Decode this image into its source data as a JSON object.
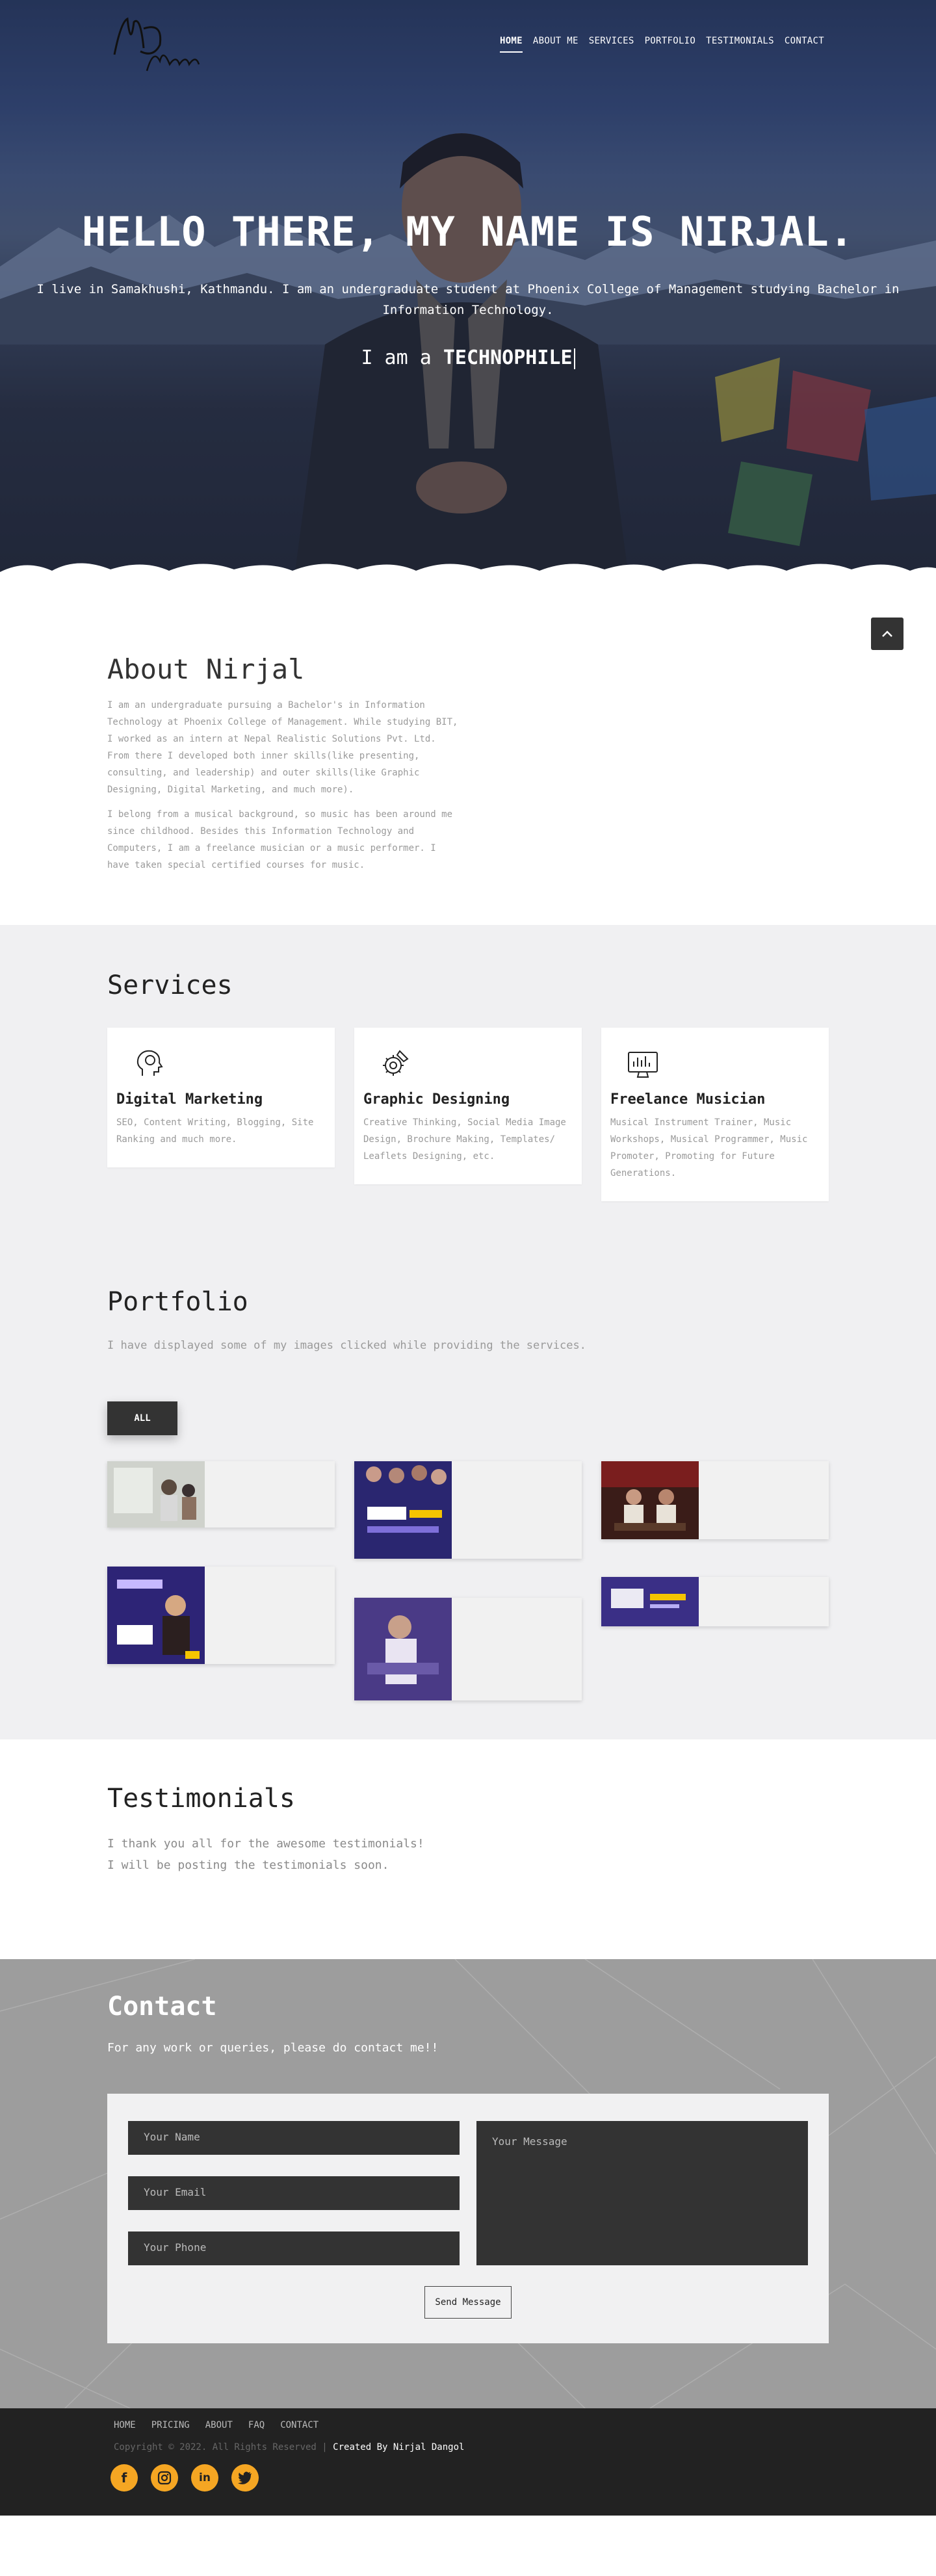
{
  "header": {
    "logo_text": "ND Music",
    "nav": [
      "HOME",
      "ABOUT ME",
      "SERVICES",
      "PORTFOLIO",
      "TESTIMONIALS",
      "CONTACT"
    ],
    "active_nav": "HOME"
  },
  "hero": {
    "title": "HELLO THERE, MY NAME IS NIRJAL.",
    "intro": "I live in Samakhushi, Kathmandu. I am an undergraduate student at Phoenix College of Management studying Bachelor in Information Technology.",
    "typed_prefix": "I am a ",
    "typed_word": "TECHNOPHILE"
  },
  "about": {
    "title": "About Nirjal",
    "para1": "I am an undergraduate pursuing a Bachelor's in Information Technology at Phoenix College of Management. While studying BIT, I worked as an intern at Nepal Realistic Solutions Pvt. Ltd. From there I developed both inner skills(like presenting, consulting, and leadership) and outer skills(like Graphic Designing, Digital Marketing, and much more).",
    "para2": "I belong from a musical background, so music has been around me since childhood. Besides this Information Technology and Computers, I am a freelance musician or a music performer. I have taken special certified courses for music."
  },
  "services": {
    "title": "Services",
    "items": [
      {
        "title": "Digital Marketing",
        "desc": "SEO, Content Writing, Blogging, Site Ranking and much more.",
        "icon": "marketing-icon"
      },
      {
        "title": "Graphic Designing",
        "desc": "Creative Thinking, Social Media Image Design, Brochure Making, Templates/ Leaflets Designing, etc.",
        "icon": "design-gear-icon"
      },
      {
        "title": "Freelance Musician",
        "desc": "Musical Instrument Trainer, Music Workshops, Musical Programmer, Music Promoter, Promoting for Future Generations.",
        "icon": "monitor-icon"
      }
    ]
  },
  "portfolio": {
    "title": "Portfolio",
    "subtitle": "I have displayed some of my images clicked while providing the services.",
    "filter_all": "ALL"
  },
  "testimonials": {
    "title": "Testimonials",
    "line1": "I thank you all for the awesome testimonials!",
    "line2": "I will be posting the testimonials soon."
  },
  "contact": {
    "title": "Contact",
    "lead": "For any work or queries, please do contact me!!",
    "name_placeholder": "Your Name",
    "email_placeholder": "Your Email",
    "phone_placeholder": "Your Phone",
    "message_placeholder": "Your Message",
    "send_label": "Send Message"
  },
  "footer": {
    "nav": [
      "HOME",
      "PRICING",
      "ABOUT",
      "FAQ",
      "CONTACT"
    ],
    "copyright": "Copyright © 2022. All Rights Reserved | ",
    "credit": "Created By Nirjal Dangol",
    "socials": [
      "facebook-icon",
      "instagram-icon",
      "linkedin-icon",
      "twitter-icon"
    ]
  },
  "colors": {
    "dark": "#333333",
    "accent": "#f5a623",
    "grey_bg": "#f0f0f2"
  }
}
